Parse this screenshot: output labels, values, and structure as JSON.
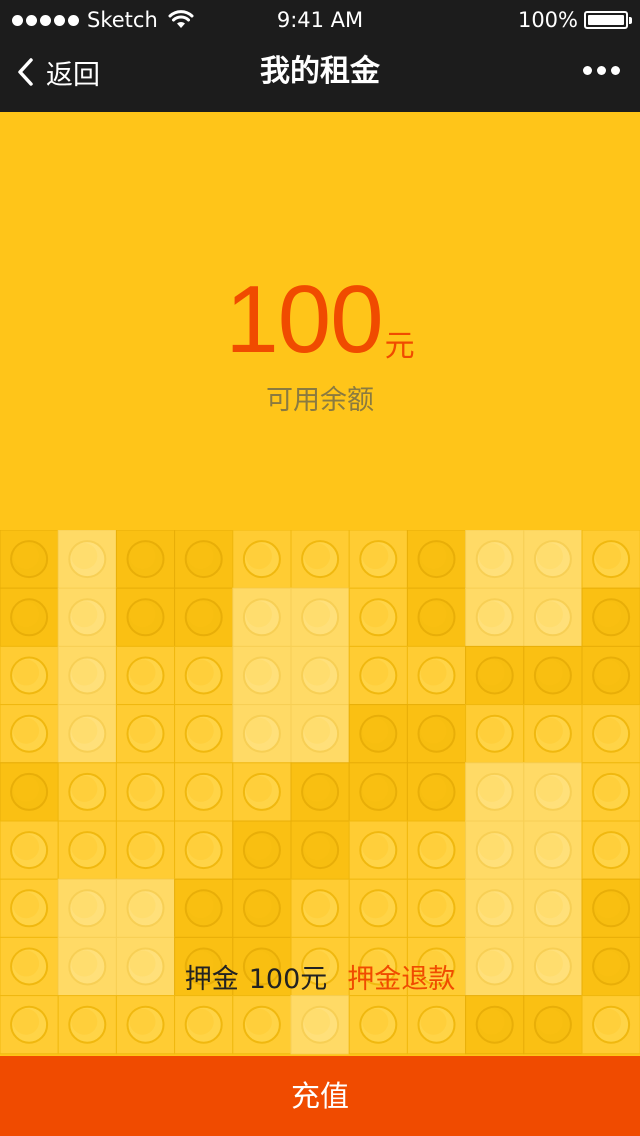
{
  "status_bar": {
    "carrier": "Sketch",
    "time": "9:41 AM",
    "battery": "100%"
  },
  "nav": {
    "back_label": "返回",
    "title": "我的租金"
  },
  "balance": {
    "amount": "100",
    "unit": "元",
    "label": "可用余额"
  },
  "deposit": {
    "label": "押金",
    "amount": "100元",
    "refund_link": "押金退款"
  },
  "actions": {
    "recharge_label": "充值"
  },
  "colors": {
    "background": "#FFC519",
    "accent": "#F04B00",
    "bar": "#1c1c1c"
  }
}
